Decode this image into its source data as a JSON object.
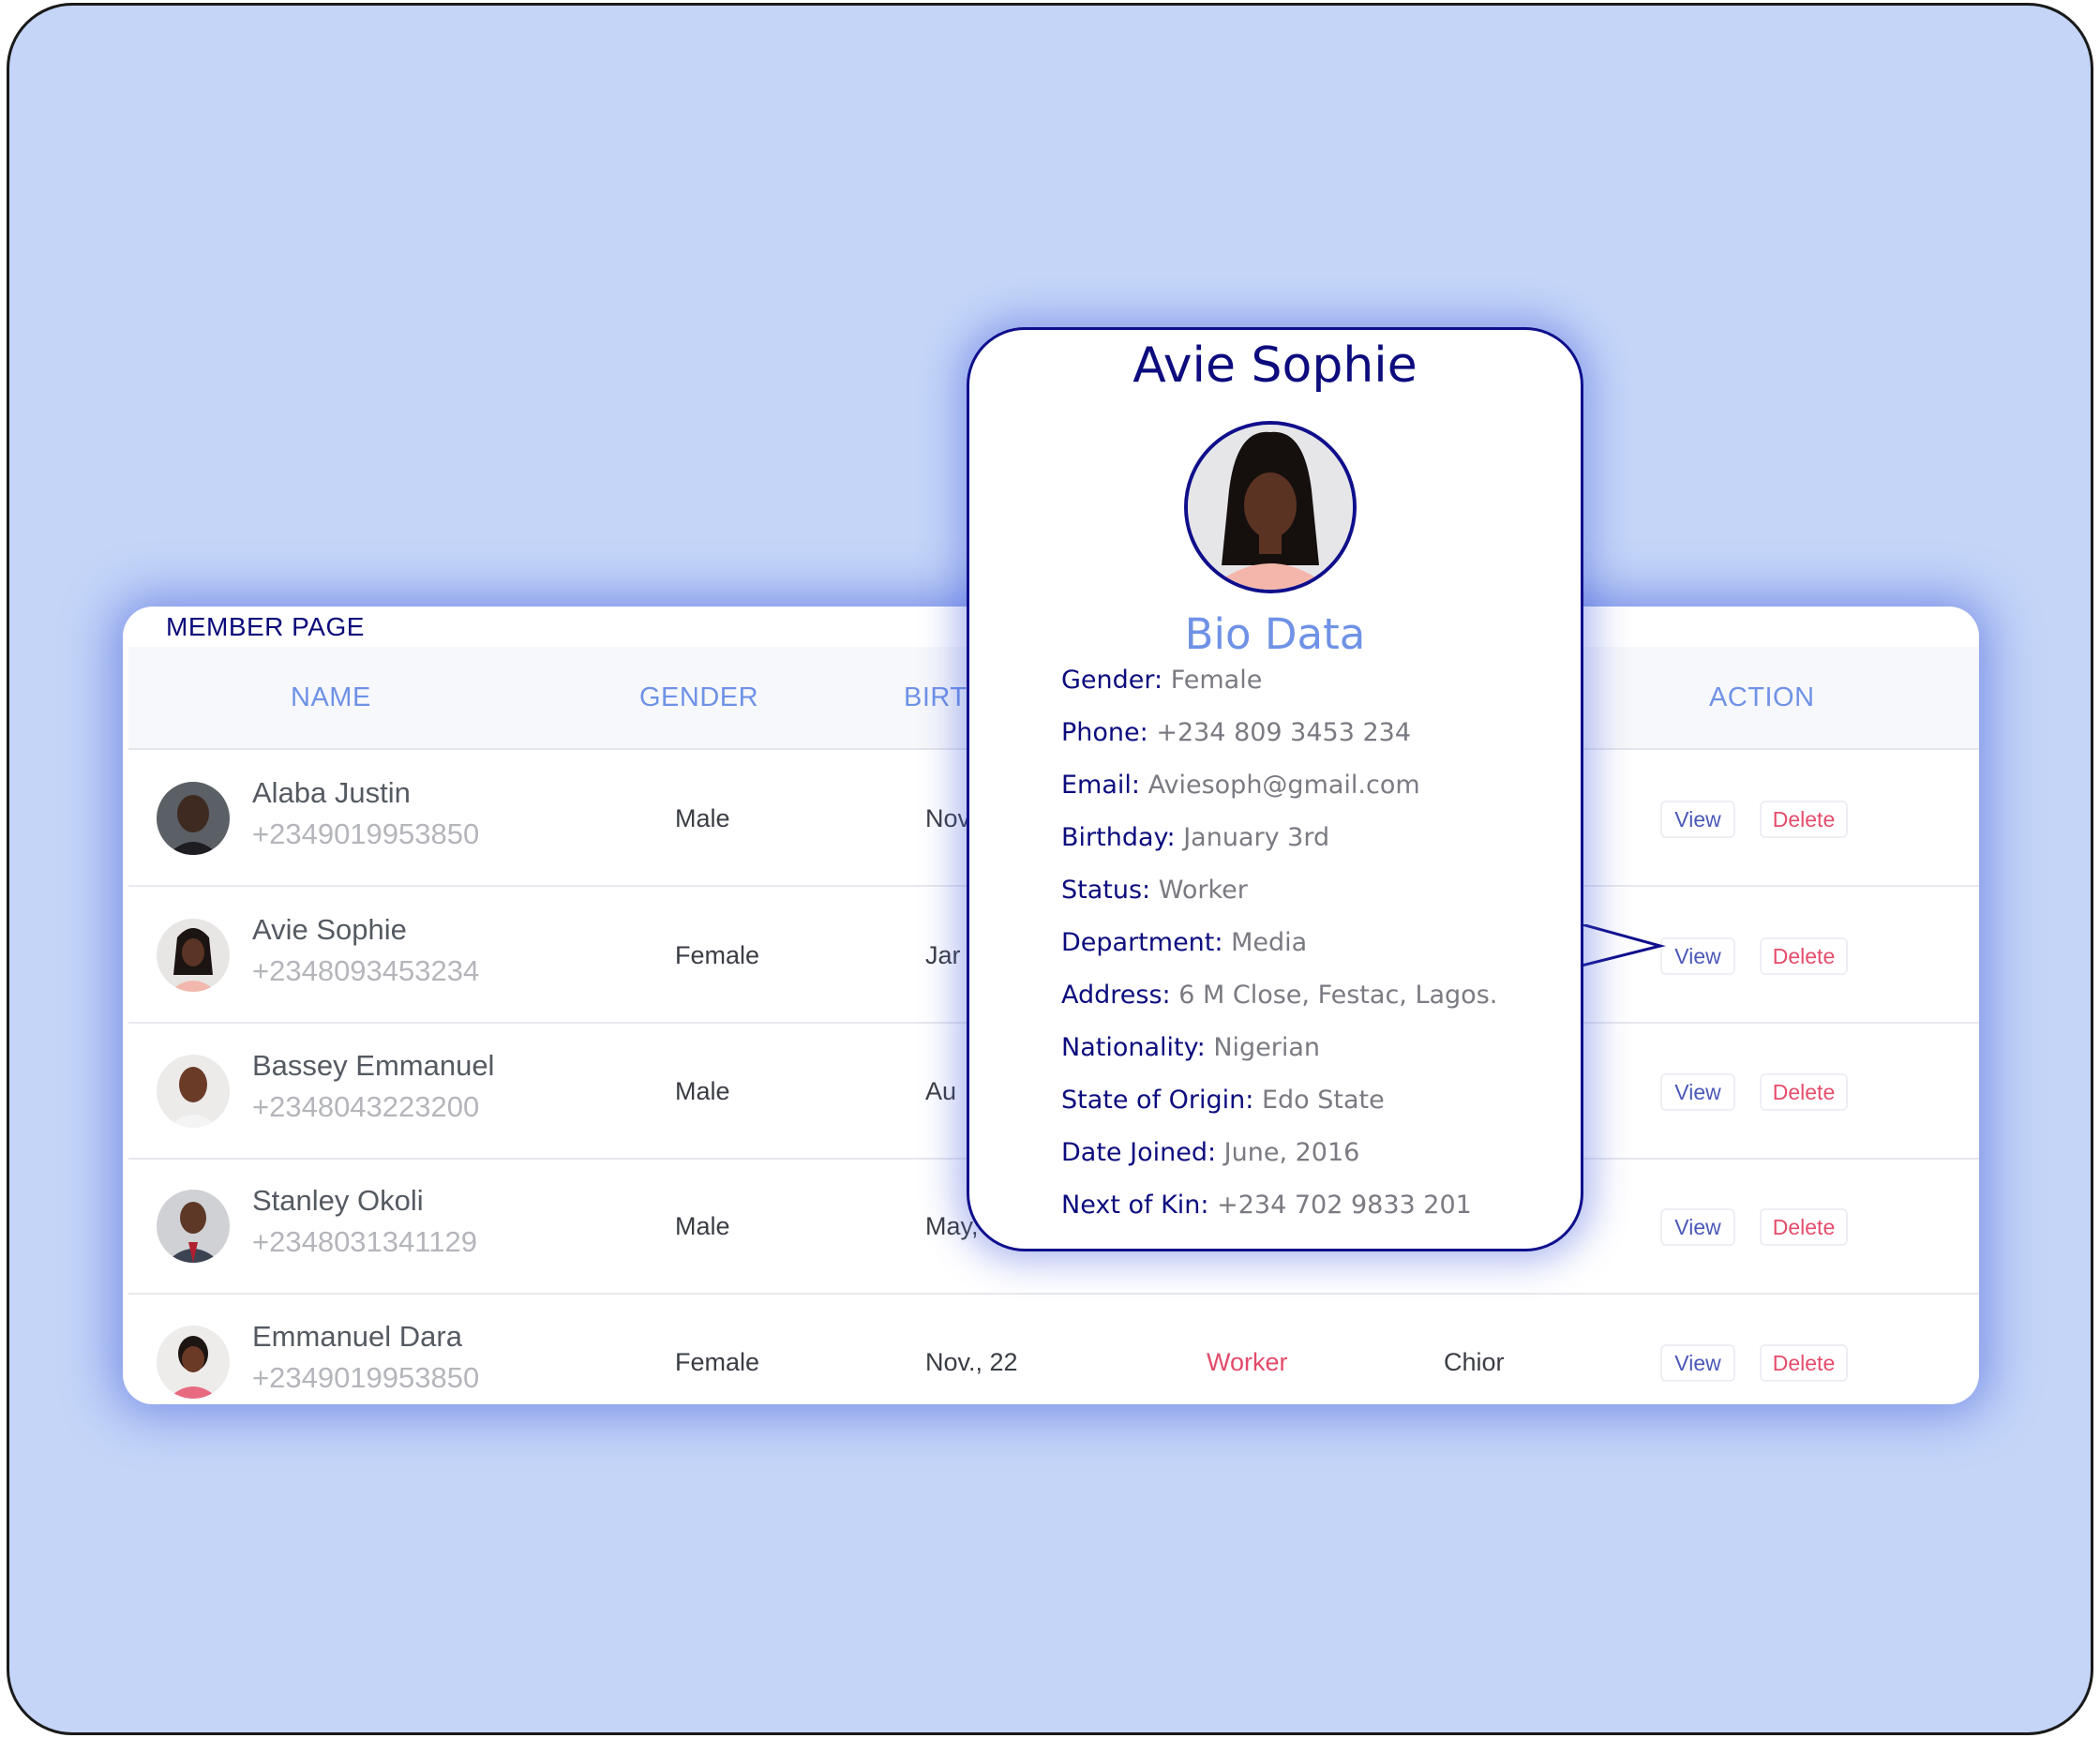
{
  "page_title": "MEMBER PAGE",
  "columns": {
    "name": "NAME",
    "gender": "GENDER",
    "birthday": "BIRTH",
    "action": "ACTION"
  },
  "actions": {
    "view": "View",
    "delete": "Delete"
  },
  "members": [
    {
      "name": "Alaba Justin",
      "phone": "+2349019953850",
      "gender": "Male",
      "birthday": "Nov",
      "status": "",
      "department": ""
    },
    {
      "name": "Avie Sophie",
      "phone": "+2348093453234",
      "gender": "Female",
      "birthday": "Jar",
      "status": "",
      "department": ""
    },
    {
      "name": "Bassey Emmanuel",
      "phone": "+2348043223200",
      "gender": "Male",
      "birthday": "Au",
      "status": "",
      "department": ""
    },
    {
      "name": "Stanley Okoli",
      "phone": "+2348031341129",
      "gender": "Male",
      "birthday": "May,",
      "status": "",
      "department": ""
    },
    {
      "name": "Emmanuel Dara",
      "phone": "+2349019953850",
      "gender": "Female",
      "birthday": "Nov., 22",
      "status": "Worker",
      "department": "Chior"
    }
  ],
  "popover": {
    "name": "Avie Sophie",
    "section_title": "Bio Data",
    "fields": [
      {
        "label": "Gender:",
        "value": "Female"
      },
      {
        "label": "Phone:",
        "value": "+234 809 3453 234"
      },
      {
        "label": "Email:",
        "value": "Aviesoph@gmail.com"
      },
      {
        "label": "Birthday:",
        "value": "January 3rd"
      },
      {
        "label": "Status:",
        "value": "Worker"
      },
      {
        "label": "Department:",
        "value": "Media"
      },
      {
        "label": "Address:",
        "value": "6 M Close, Festac, Lagos."
      },
      {
        "label": "Nationality:",
        "value": "Nigerian"
      },
      {
        "label": "State of Origin:",
        "value": "Edo State"
      },
      {
        "label": "Date Joined:",
        "value": "June, 2016"
      },
      {
        "label": "Next of Kin:",
        "value": "+234 702 9833 201"
      }
    ]
  },
  "colors": {
    "background": "#c4d5f8",
    "navy": "#0c0c7e",
    "header_blue": "#6f92e6",
    "delete_red": "#e44d6c",
    "status_red": "#e34a6a"
  }
}
